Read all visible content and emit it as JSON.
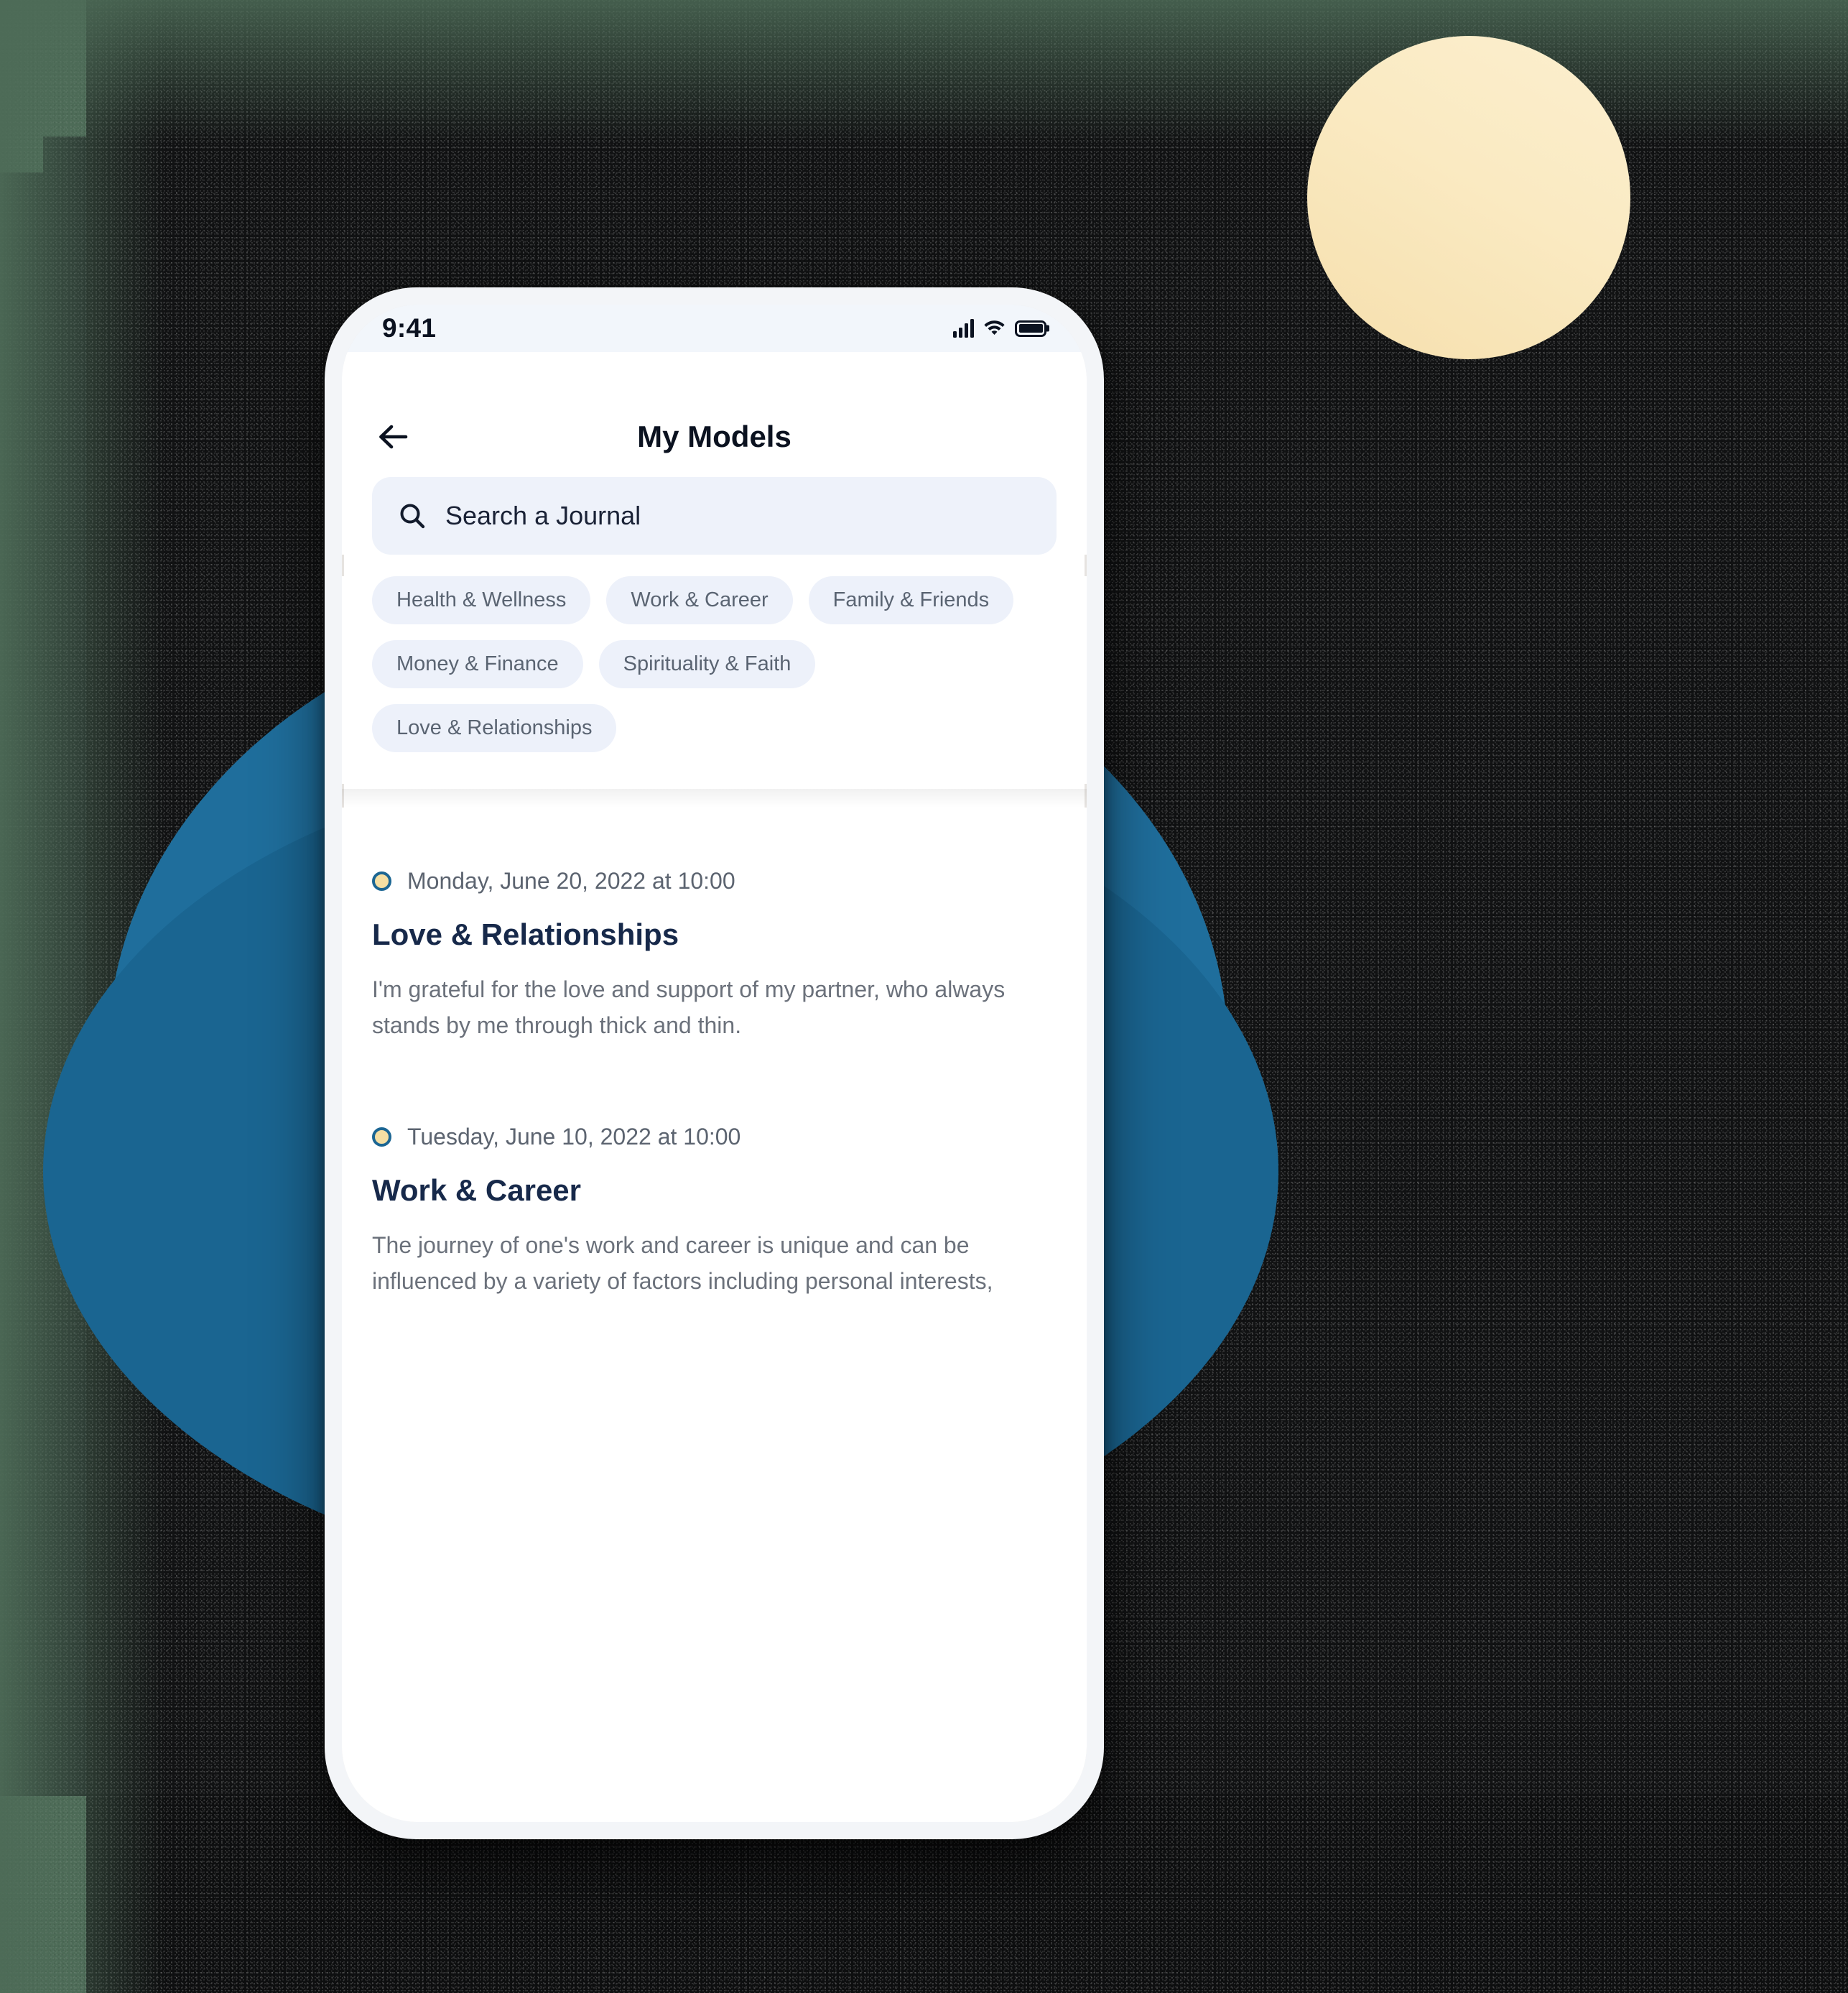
{
  "colors": {
    "backdrop_green": "#4d6b57",
    "backdrop_dark": "#111213",
    "blob_blue": "#1a6591",
    "blob_blue_back": "#1f6e9c",
    "circle_yellow": "#faeac2",
    "chip_bg": "#edf1fa",
    "search_bg": "#eef2fa",
    "title_navy": "#17294a",
    "accent_blue": "#1c6693",
    "dot_yellow": "#f5dfa3"
  },
  "status_bar": {
    "time": "9:41",
    "signal_icon": "cellular-signal-icon",
    "wifi_icon": "wifi-icon",
    "battery_icon": "battery-full-icon"
  },
  "header": {
    "back_icon": "arrow-left-icon",
    "title": "My Models"
  },
  "search": {
    "icon": "search-icon",
    "placeholder": "Search a Journal",
    "value": ""
  },
  "chips": [
    {
      "label": "Health & Wellness"
    },
    {
      "label": "Work & Career"
    },
    {
      "label": "Family & Friends"
    },
    {
      "label": "Money & Finance"
    },
    {
      "label": "Spirituality & Faith"
    },
    {
      "label": "Love & Relationships"
    }
  ],
  "entries": [
    {
      "marker_icon": "status-dot-icon",
      "date": "Monday, June 20, 2022 at 10:00",
      "title": "Love & Relationships",
      "body": "I'm grateful for the love and support of my partner, who always stands by me through thick and thin."
    },
    {
      "marker_icon": "status-dot-icon",
      "date": "Tuesday, June 10, 2022 at 10:00",
      "title": "Work & Career",
      "body": "The journey of one's work and career is unique and can be influenced by a variety of factors including personal interests,"
    }
  ]
}
